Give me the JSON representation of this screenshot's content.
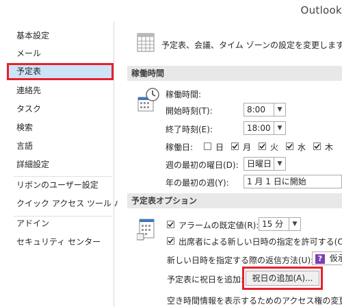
{
  "window": {
    "title": "Outlook"
  },
  "nav": {
    "items": [
      {
        "label": "基本設定"
      },
      {
        "label": "メール"
      },
      {
        "label": "予定表",
        "selected": true
      },
      {
        "label": "連絡先"
      },
      {
        "label": "タスク"
      },
      {
        "label": "検索"
      },
      {
        "label": "言語"
      },
      {
        "label": "詳細設定"
      },
      {
        "label": "リボンのユーザー設定"
      },
      {
        "label": "クイック アクセス ツール バー"
      },
      {
        "label": "アドイン"
      },
      {
        "label": "セキュリティ センター"
      }
    ]
  },
  "header": {
    "text": "予定表、会議、タイム ゾーンの設定を変更します。"
  },
  "work_time": {
    "section_title": "稼働時間",
    "heading": "稼働時間:",
    "start_label": "開始時刻(T):",
    "start_value": "8:00",
    "end_label": "終了時刻(E):",
    "end_value": "18:00",
    "days_label": "稼働日:",
    "days": [
      {
        "label": "日",
        "checked": false
      },
      {
        "label": "月",
        "checked": true
      },
      {
        "label": "火",
        "checked": true
      },
      {
        "label": "水",
        "checked": true
      },
      {
        "label": "木",
        "checked": true
      }
    ],
    "first_day_label": "週の最初の曜日(D):",
    "first_day_value": "日曜日",
    "first_week_label": "年の最初の週(Y):",
    "first_week_value": "1 月 1 日に開始"
  },
  "calendar_options": {
    "section_title": "予定表オプション",
    "alarm_label": "アラームの既定値(R):",
    "alarm_checked": true,
    "alarm_value": "15 分",
    "attendees_label": "出席者による新しい日時の指定を許可する(O)",
    "attendees_checked": true,
    "reply_label": "新しい日時を指定する際の返信方法(U):",
    "reply_value": "仮承",
    "holidays_label": "予定表に祝日を追加:",
    "holidays_button": "祝日の追加(A)...",
    "access_label": "空き時間情報を表示するためのアクセス権の変更:"
  }
}
